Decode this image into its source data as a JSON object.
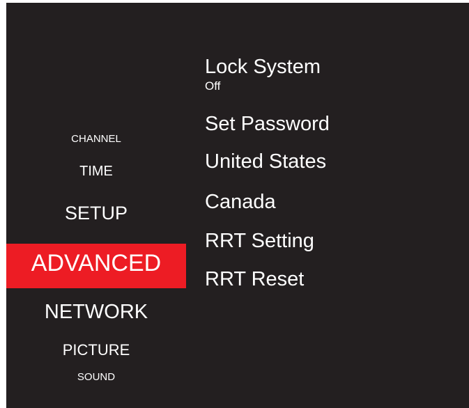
{
  "colors": {
    "background": "#231f20",
    "text": "#ffffff",
    "selected_highlight": "#ed1c24"
  },
  "left_menu": {
    "items": [
      {
        "label": "CHANNEL",
        "selected": false
      },
      {
        "label": "TIME",
        "selected": false
      },
      {
        "label": "SETUP",
        "selected": false
      },
      {
        "label": "ADVANCED",
        "selected": true
      },
      {
        "label": "NETWORK",
        "selected": false
      },
      {
        "label": "PICTURE",
        "selected": false
      },
      {
        "label": "SOUND",
        "selected": false
      }
    ]
  },
  "right_menu": {
    "lock_system": {
      "label": "Lock System",
      "value": "Off"
    },
    "set_password": {
      "label": "Set Password"
    },
    "united_states": {
      "label": "United States"
    },
    "canada": {
      "label": "Canada"
    },
    "rrt_setting": {
      "label": "RRT Setting"
    },
    "rrt_reset": {
      "label": "RRT Reset"
    }
  }
}
